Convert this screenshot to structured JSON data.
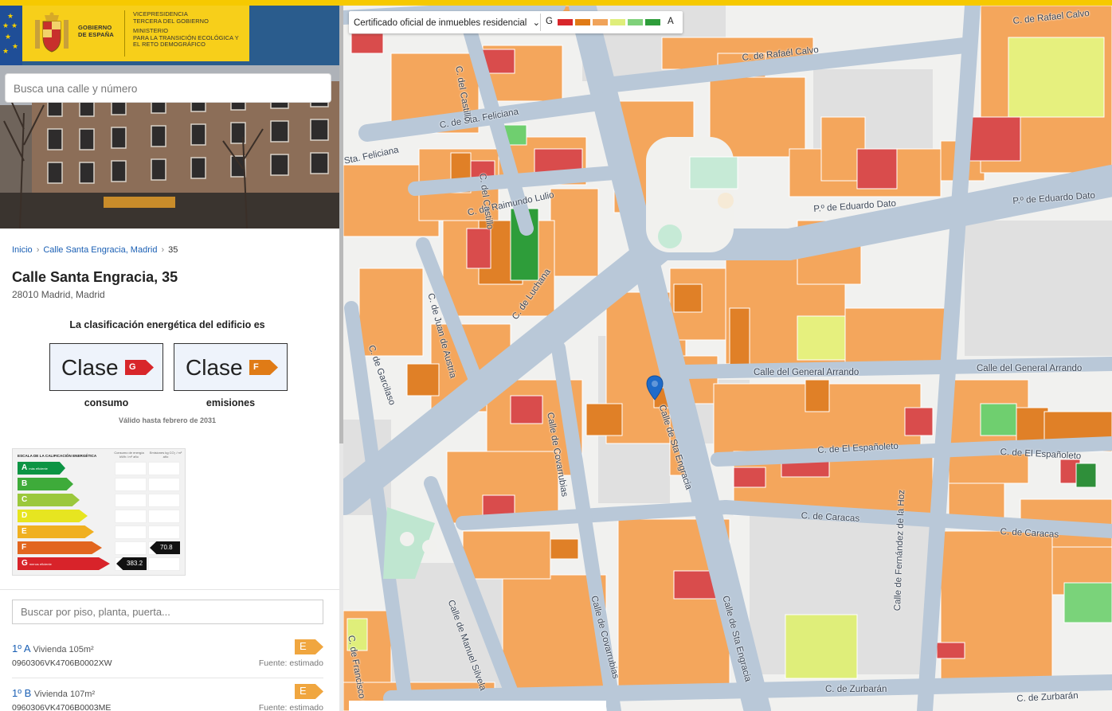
{
  "header": {
    "gov_name": [
      "GOBIERNO",
      "DE ESPAÑA"
    ],
    "ministry": [
      "VICEPRESIDENCIA",
      "TERCERA DEL GOBIERNO",
      "",
      "MINISTERIO",
      "PARA LA TRANSICIÓN ECOLÓGICA Y",
      "EL RETO DEMOGRÁFICO"
    ]
  },
  "search": {
    "placeholder": "Busca una calle y número"
  },
  "breadcrumb": {
    "home": "Inicio",
    "street": "Calle Santa Engracia, Madrid",
    "number": "35"
  },
  "address": {
    "title": "Calle Santa Engracia, 35",
    "subtitle": "28010 Madrid, Madrid"
  },
  "classification": {
    "heading": "La clasificación energética del edificio es",
    "word": "Clase",
    "consumption": {
      "letter": "G",
      "label": "consumo",
      "color": "#d8262a"
    },
    "emissions": {
      "letter": "F",
      "label": "emisiones",
      "color": "#e07b16"
    },
    "valid_until": "Válido hasta febrero de 2031"
  },
  "scale": {
    "title": "ESCALA DE LA CALIFICACIÓN ENERGÉTICA",
    "col1": "Consumo de energía kWh / m² año",
    "col2": "Emisiones kg CO₂ / m² año",
    "best_label": "más eficiente",
    "worst_label": "menos eficiente",
    "letters": [
      "A",
      "B",
      "C",
      "D",
      "E",
      "F",
      "G"
    ],
    "colors": [
      "#0c9444",
      "#3eab3a",
      "#9bc83c",
      "#e7e520",
      "#f0b020",
      "#e2661f",
      "#d8232a"
    ],
    "emissions_value": "70.8",
    "consumption_value": "383.2"
  },
  "floors": {
    "placeholder": "Buscar por piso, planta, puerta...",
    "units": [
      {
        "floor": "1º A",
        "desc": "Vivienda 105m²",
        "ref": "0960306VK4706B0002XW",
        "source": "Fuente: estimado",
        "rating": "E"
      },
      {
        "floor": "1º B",
        "desc": "Vivienda 107m²",
        "ref": "0960306VK4706B0003ME",
        "source": "Fuente: estimado",
        "rating": "E"
      }
    ]
  },
  "map": {
    "layer_select": "Certificado oficial de inmuebles residencial",
    "legend_low": "G",
    "legend_high": "A",
    "legend_colors": [
      "#d8262a",
      "#e07b16",
      "#f0a35a",
      "#dfee7a",
      "#7fd17a",
      "#2e9d3a"
    ],
    "streets": [
      "C. de Rafael Calvo",
      "C. de Rafaél Calvo",
      "C. de Sta. Feliciana",
      "Sta. Feliciana",
      "C. del Castillo",
      "C. de Raimundo Lulio",
      "P.º de Eduardo Dato",
      "P.º de Eduardo Dato",
      "C. de Juan de Austria",
      "C. de Garcilaso",
      "C. de Luchana",
      "Calle del General Arrando",
      "Calle del General Arrando",
      "Calle de Covarrubias",
      "Calle de Sta Engracia",
      "C. de El Españoleto",
      "C. de El Españoleto",
      "C. de Caracas",
      "C. de Caracas",
      "Calle de Manuel Silvela",
      "Calle de Covarrubias",
      "Calle de Sta Engracia",
      "C. de Francisco de",
      "Calle de Fernández de la Hoz",
      "C. de Zurbarán",
      "C. de Zurbarán",
      "C. del Castillo"
    ]
  }
}
